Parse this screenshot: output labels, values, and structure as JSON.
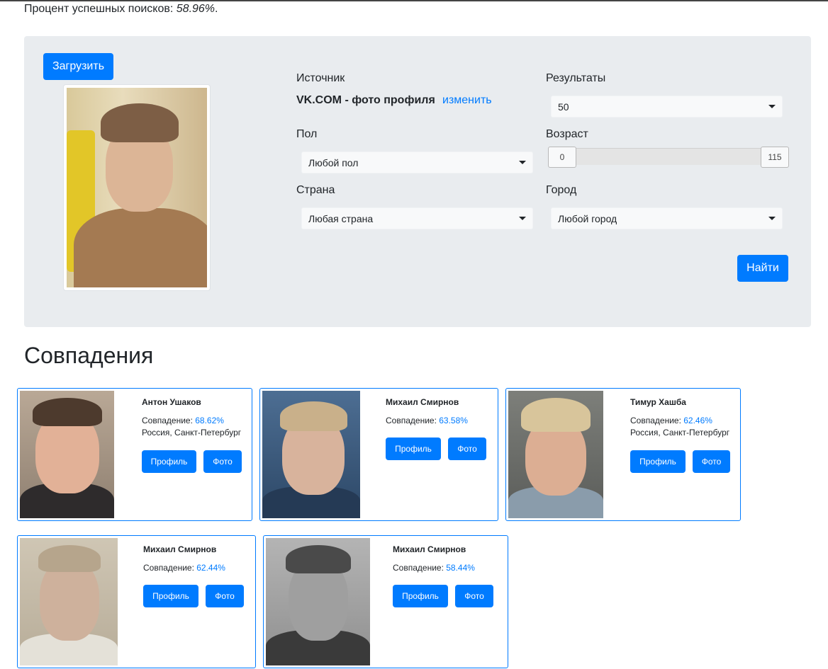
{
  "stats": {
    "label": "Процент успешных поисков:",
    "value": "58.96%",
    "suffix": "."
  },
  "search": {
    "upload_label": "Загрузить",
    "source_label": "Источник",
    "source_value": "VK.COM - фото профиля",
    "change_link": "изменить",
    "results_label": "Результаты",
    "results_value": "50",
    "gender_label": "Пол",
    "gender_value": "Любой пол",
    "age_label": "Возраст",
    "age_min": "0",
    "age_max": "115",
    "country_label": "Страна",
    "country_value": "Любая страна",
    "city_label": "Город",
    "city_value": "Любой город",
    "find_label": "Найти"
  },
  "matches": {
    "title": "Совпадения",
    "match_label": "Совпадение:",
    "profile_label": "Профиль",
    "photo_label": "Фото",
    "items": [
      {
        "name": "Антон Ушаков",
        "percent": "68.62%",
        "location": "Россия, Санкт-Петербург"
      },
      {
        "name": "Михаил Смирнов",
        "percent": "63.58%",
        "location": ""
      },
      {
        "name": "Тимур Хашба",
        "percent": "62.46%",
        "location": "Россия, Санкт-Петербург"
      },
      {
        "name": "Михаил Смирнов",
        "percent": "62.44%",
        "location": ""
      },
      {
        "name": "Михаил Смирнов",
        "percent": "58.44%",
        "location": ""
      }
    ]
  },
  "colors": {
    "primary": "#007bff",
    "panel": "#e9ecef",
    "text": "#212529"
  }
}
